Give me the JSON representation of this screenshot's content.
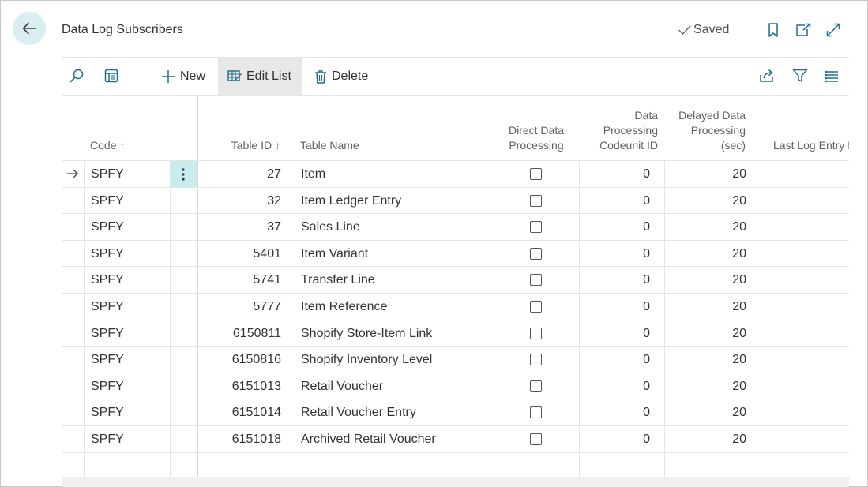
{
  "page": {
    "title": "Data Log Subscribers",
    "saved_status": "Saved"
  },
  "toolbar": {
    "new_label": "New",
    "edit_list_label": "Edit List",
    "delete_label": "Delete"
  },
  "columns": {
    "code": "Code",
    "table_id": "Table ID",
    "table_name": "Table Name",
    "direct_line1": "Direct Data",
    "direct_line2": "Processing",
    "codeunit_line1": "Data",
    "codeunit_line2": "Processing",
    "codeunit_line3": "Codeunit ID",
    "delayed_line1": "Delayed Data",
    "delayed_line2": "Processing",
    "delayed_line3": "(sec)",
    "last_log": "Last Log Entry I"
  },
  "sort_indicator": "↑",
  "rows": [
    {
      "code": "SPFY",
      "table_id": "27",
      "table_name": "Item",
      "direct": false,
      "codeunit": "0",
      "delay": "20"
    },
    {
      "code": "SPFY",
      "table_id": "32",
      "table_name": "Item Ledger Entry",
      "direct": false,
      "codeunit": "0",
      "delay": "20"
    },
    {
      "code": "SPFY",
      "table_id": "37",
      "table_name": "Sales Line",
      "direct": false,
      "codeunit": "0",
      "delay": "20"
    },
    {
      "code": "SPFY",
      "table_id": "5401",
      "table_name": "Item Variant",
      "direct": false,
      "codeunit": "0",
      "delay": "20"
    },
    {
      "code": "SPFY",
      "table_id": "5741",
      "table_name": "Transfer Line",
      "direct": false,
      "codeunit": "0",
      "delay": "20"
    },
    {
      "code": "SPFY",
      "table_id": "5777",
      "table_name": "Item Reference",
      "direct": false,
      "codeunit": "0",
      "delay": "20"
    },
    {
      "code": "SPFY",
      "table_id": "6150811",
      "table_name": "Shopify Store-Item Link",
      "direct": false,
      "codeunit": "0",
      "delay": "20"
    },
    {
      "code": "SPFY",
      "table_id": "6150816",
      "table_name": "Shopify Inventory Level",
      "direct": false,
      "codeunit": "0",
      "delay": "20"
    },
    {
      "code": "SPFY",
      "table_id": "6151013",
      "table_name": "Retail Voucher",
      "direct": false,
      "codeunit": "0",
      "delay": "20"
    },
    {
      "code": "SPFY",
      "table_id": "6151014",
      "table_name": "Retail Voucher Entry",
      "direct": false,
      "codeunit": "0",
      "delay": "20"
    },
    {
      "code": "SPFY",
      "table_id": "6151018",
      "table_name": "Archived Retail Voucher",
      "direct": false,
      "codeunit": "0",
      "delay": "20"
    }
  ],
  "colors": {
    "accent_light": "#d9eef0",
    "selected_cell": "#c8ecef",
    "icon_color": "#1f6f8b"
  },
  "icons": {
    "back": "back-arrow-icon",
    "bookmark": "bookmark-icon",
    "open_new": "open-in-new-window-icon",
    "expand": "expand-icon",
    "search": "search-icon",
    "show_pane": "show-pane-icon",
    "new": "plus-icon",
    "edit_list": "edit-list-icon",
    "delete": "trash-icon",
    "share": "share-icon",
    "filter": "filter-icon",
    "list_view": "list-view-icon"
  }
}
